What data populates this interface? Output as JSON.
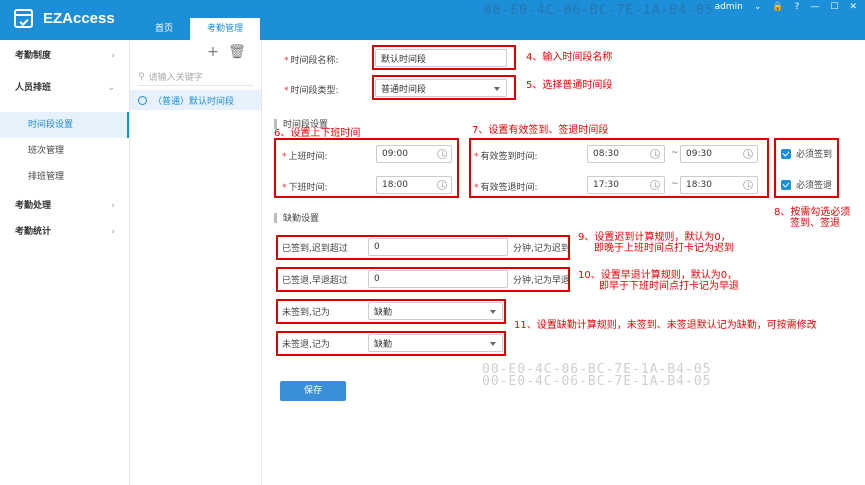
{
  "app": {
    "title": "EZAccess",
    "user": "admin"
  },
  "watermark": {
    "top": "00-E0-4C-06-BC-7E-1A-B4-05",
    "mid1": "00-E0-4C-06-BC-7E-1A-B4-05",
    "mid2": "00-E0-4C-06-BC-7E-1A-B4-05"
  },
  "topnav": {
    "home": "首页",
    "attendance": "考勤管理"
  },
  "sidebar": {
    "g1": "考勤制度",
    "g2": "人员排班",
    "items": [
      "时间段设置",
      "班次管理",
      "排班管理"
    ],
    "g3": "考勤处理",
    "g4": "考勤统计"
  },
  "tree": {
    "search_placeholder": "请输入关键字",
    "node": "（普通）默认时间段",
    "add": "+",
    "delete": "🗑"
  },
  "form": {
    "name_label": "时间段名称:",
    "name_value": "默认时间段",
    "type_label": "时间段类型:",
    "type_value": "普通时间段",
    "section1": "时间段设置",
    "on_label": "上班时间:",
    "on_value": "09:00",
    "off_label": "下班时间:",
    "off_value": "18:00",
    "signin_label": "有效签到时间:",
    "signin_from": "08:30",
    "signin_to": "09:30",
    "signout_label": "有效签退时间:",
    "signout_from": "17:30",
    "signout_to": "18:30",
    "tilde": "~",
    "must_signin": "必须签到",
    "must_signout": "必须签退",
    "section2": "缺勤设置",
    "late_label": "已签到,迟到超过",
    "late_value": "0",
    "late_suffix": "分钟,记为迟到",
    "early_label": "已签退,早退超过",
    "early_value": "0",
    "early_suffix": "分钟,记为早退",
    "nosignin_label": "未签到,记为",
    "nosignin_value": "缺勤",
    "nosignout_label": "未签退,记为",
    "nosignout_value": "缺勤",
    "save": "保存"
  },
  "annotations": {
    "a4": "4、输入时间段名称",
    "a5": "5、选择普通时间段",
    "a6": "6、设置上下班时间",
    "a7": "7、设置有效签到、签退时间段",
    "a8_1": "8、按需勾选必须",
    "a8_2": "签到、签退",
    "a9_1": "9、设置迟到计算规则，默认为0，",
    "a9_2": "即晚于上班时间点打卡记为迟到",
    "a10_1": "10、设置早退计算规则，默认为0，",
    "a10_2": "即早于下班时间点打卡记为早退",
    "a11": "11、设置缺勤计算规则，未签到、未签退默认记为缺勤，可按需修改"
  }
}
